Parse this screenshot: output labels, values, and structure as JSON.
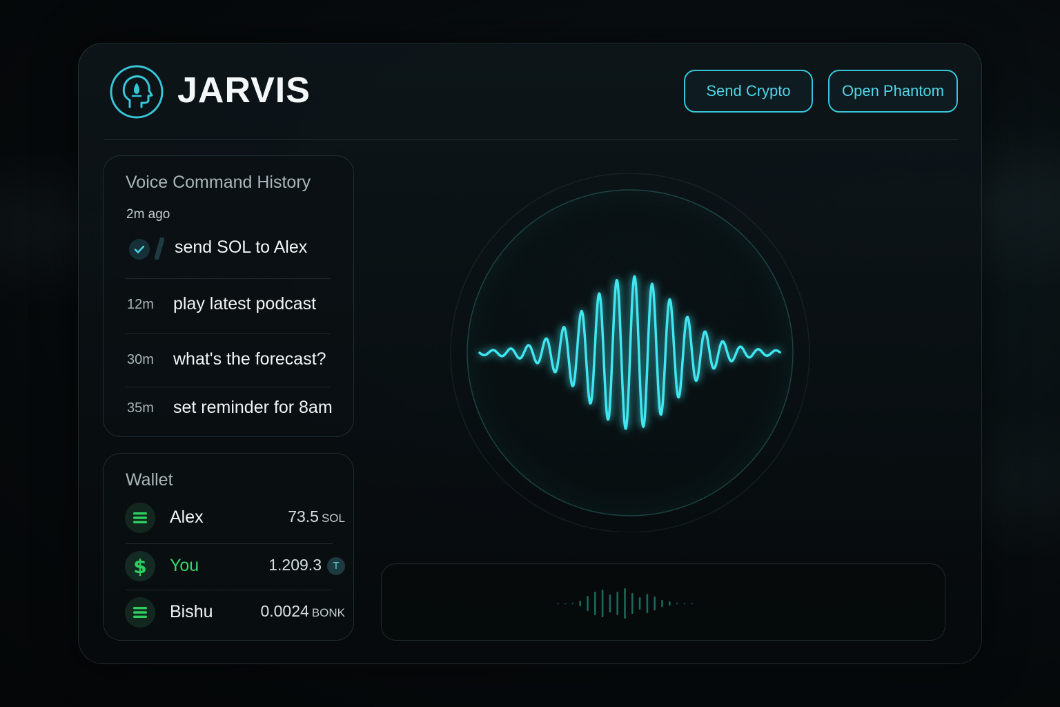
{
  "app": {
    "title": "JARVIS",
    "logo_icon": "head-profile-icon",
    "accent_color": "#37c6d8"
  },
  "header": {
    "buttons": [
      {
        "label": "Send Crypto"
      },
      {
        "label": "Open Phantom"
      }
    ]
  },
  "history": {
    "title": "Voice Command History",
    "first_time": "2m ago",
    "items": [
      {
        "time": "",
        "command": "send SOL to Alex",
        "status_icon": "check-icon"
      },
      {
        "time": "12m",
        "command": "play latest podcast"
      },
      {
        "time": "30m",
        "command": "what's the forecast?"
      },
      {
        "time": "35m",
        "command": "set reminder for 8am"
      }
    ]
  },
  "wallet": {
    "title": "Wallet",
    "entries": [
      {
        "name": "Alex",
        "amount": "73.5",
        "unit": "SOL",
        "icon": "solana-icon"
      },
      {
        "name": "You",
        "amount": "1.209.3",
        "unit": "T",
        "icon": "dollar-icon"
      },
      {
        "name": "Bishu",
        "amount": "0.0024",
        "unit": "BONK",
        "icon": "solana-icon"
      }
    ]
  },
  "visualizer": {
    "icon": "voice-waveform-icon",
    "wave_color": "#3fe6f0"
  },
  "input_bar": {
    "icon": "mini-waveform-icon"
  }
}
